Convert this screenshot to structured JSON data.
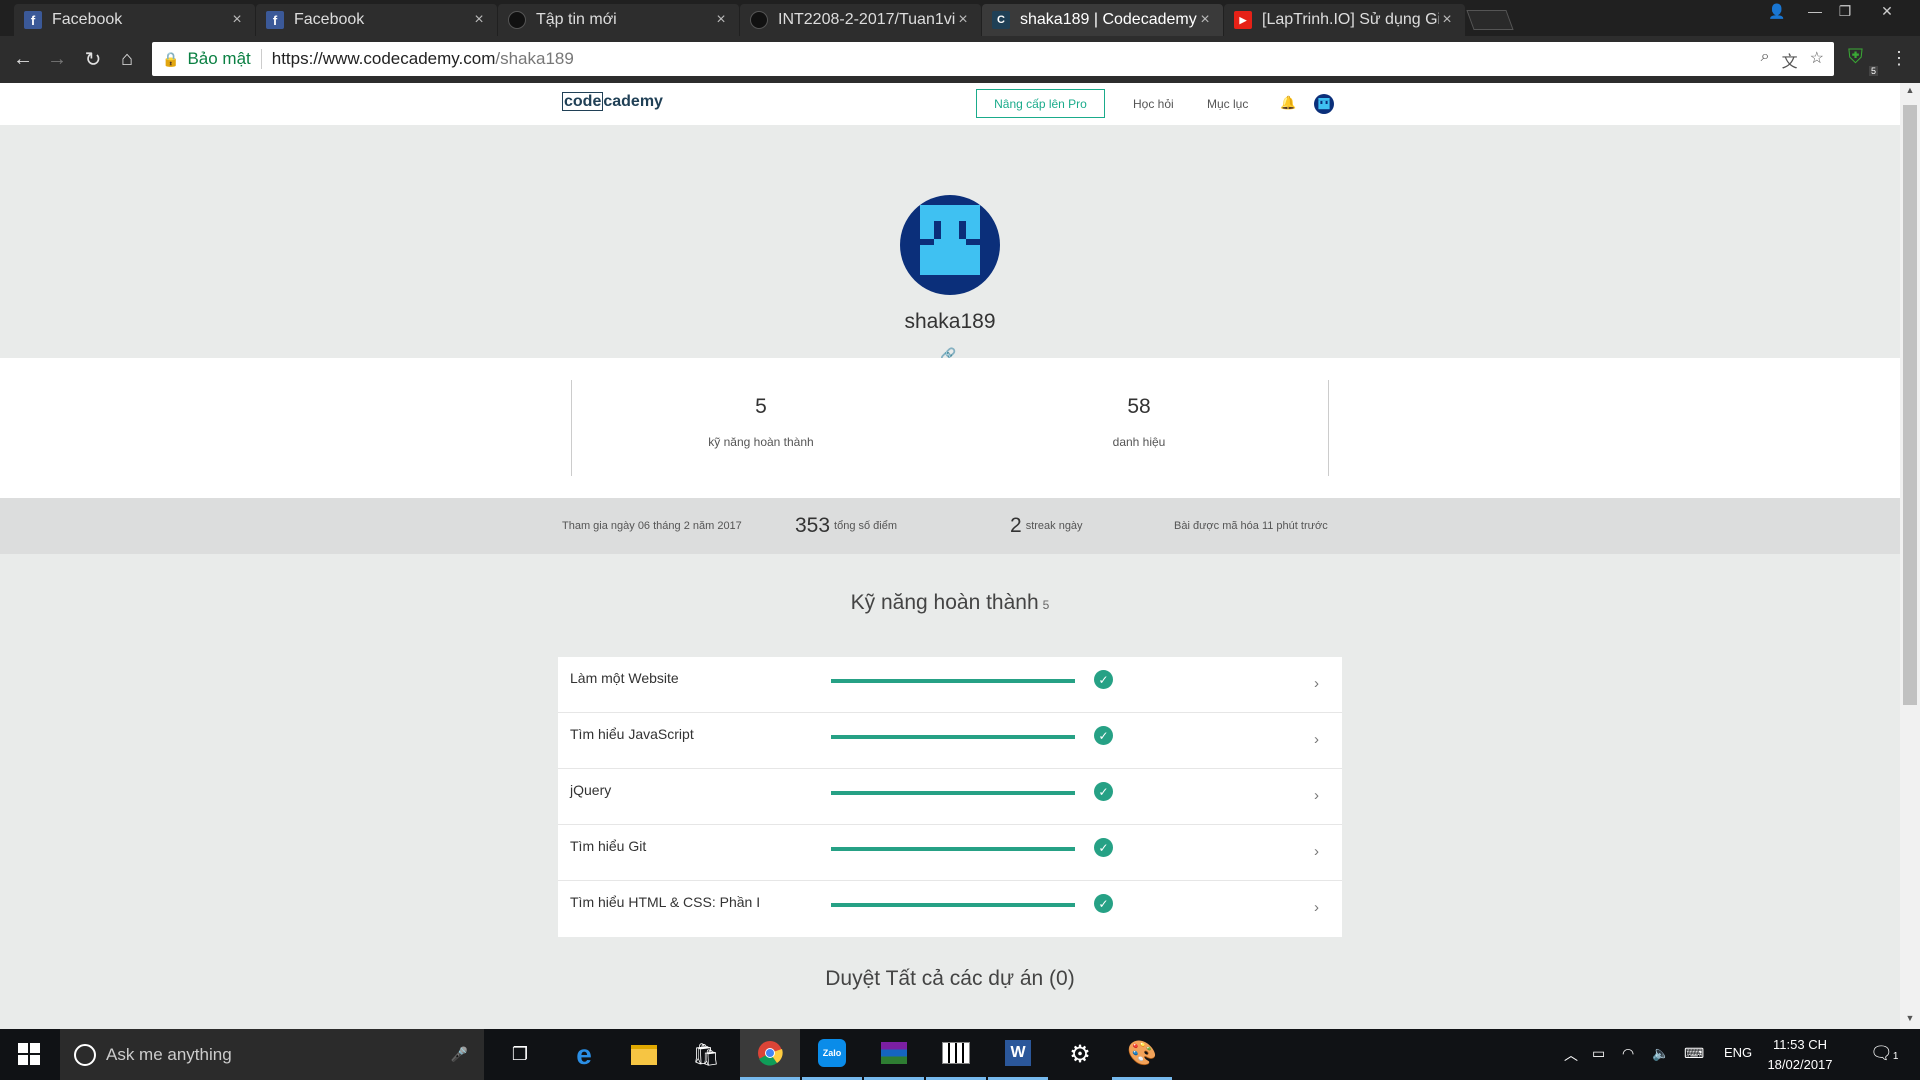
{
  "browser": {
    "tabs": [
      {
        "title": "Facebook",
        "favicon": "facebook-icon",
        "active": false
      },
      {
        "title": "Facebook",
        "favicon": "facebook-icon",
        "active": false
      },
      {
        "title": "Tập tin mới",
        "favicon": "github-icon",
        "active": false
      },
      {
        "title": "INT2208-2-2017/Tuan1vi",
        "favicon": "github-icon",
        "active": false
      },
      {
        "title": "shaka189 | Codecademy",
        "favicon": "codecademy-icon",
        "active": true
      },
      {
        "title": "[LapTrinh.IO] Sử dụng Git",
        "favicon": "youtube-icon",
        "active": false
      }
    ],
    "secure_label": "Bảo mật",
    "url_host": "https://www.codecademy.com",
    "url_path": "/shaka189",
    "extension_badge": "5"
  },
  "site": {
    "logo_part1": "code",
    "logo_part2": "cademy",
    "upgrade_label": "Nâng cấp lên Pro",
    "nav": {
      "learn": "Học hỏi",
      "catalog": "Mục lục"
    }
  },
  "profile": {
    "username": "shaka189",
    "stats": [
      {
        "value": "5",
        "label": "kỹ năng hoàn thành"
      },
      {
        "value": "58",
        "label": "danh hiệu"
      }
    ],
    "joined": "Tham gia ngày 06 tháng 2 năm 2017",
    "points_value": "353",
    "points_label": "tổng số điểm",
    "streak_value": "2",
    "streak_label": "streak ngày",
    "last_coded": "Bài được mã hóa 11 phút trước"
  },
  "skills_section": {
    "title": "Kỹ năng hoàn thành",
    "count": "5",
    "items": [
      {
        "name": "Làm một Website",
        "progress": 1.0
      },
      {
        "name": "Tìm hiểu JavaScript",
        "progress": 1.0
      },
      {
        "name": "jQuery",
        "progress": 1.0
      },
      {
        "name": "Tìm hiểu Git",
        "progress": 1.0
      },
      {
        "name": "Tìm hiểu HTML & CSS: Phần I",
        "progress": 1.0
      }
    ]
  },
  "projects_section": {
    "title": "Duyệt Tất cả các dự án (0)"
  },
  "colors": {
    "accent": "#26a185",
    "avatar": "#0b2f7a",
    "avatar_pattern": "#3fc1f2"
  },
  "taskbar": {
    "search_placeholder": "Ask me anything",
    "language": "ENG",
    "time": "11:53 CH",
    "date": "18/02/2017",
    "notification_count": "1"
  }
}
